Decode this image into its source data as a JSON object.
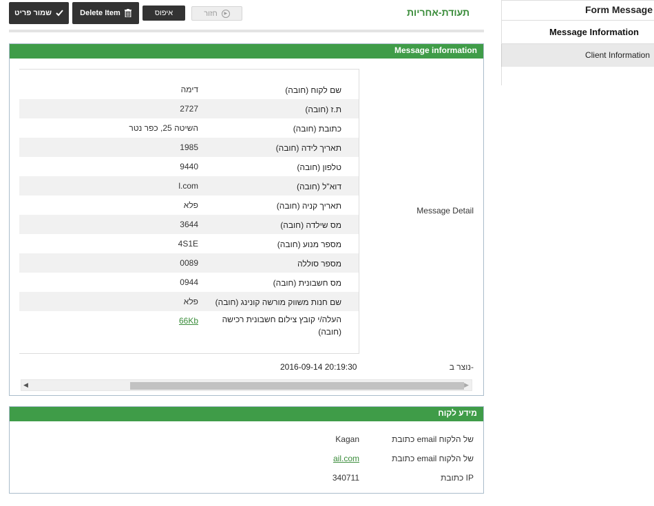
{
  "sidebar": {
    "title": "Form Message",
    "items": [
      {
        "label": "Message Information"
      },
      {
        "label": "Client Information"
      }
    ]
  },
  "toolbar": {
    "save_label": "שמור פריט",
    "delete_label": "Delete Item",
    "reset_label": "איפוס",
    "back_label": "חזור",
    "page_title": "תעודת-אחריות"
  },
  "message_panel": {
    "heading": "Message information",
    "detail_label": "Message Detail",
    "rows": [
      {
        "label": "שם לקוח (חובה)",
        "value": "דימה"
      },
      {
        "label": "ת.ז (חובה)",
        "value": "2727"
      },
      {
        "label": "כתובת (חובה)",
        "value": "השיטה 25, כפר נטר"
      },
      {
        "label": "תאריך לידה (חובה)",
        "value": "1985"
      },
      {
        "label": "טלפון (חובה)",
        "value": "9440"
      },
      {
        "label": "דוא\"ל (חובה)",
        "value": "l.com"
      },
      {
        "label": "תאריך קניה (חובה)",
        "value": "פלא"
      },
      {
        "label": "מס שילדה (חובה)",
        "value": "3644"
      },
      {
        "label": "מספר מנוע (חובה)",
        "value": "4S1E"
      },
      {
        "label": "מספר סוללה",
        "value": "0089"
      },
      {
        "label": "מס חשבונית (חובה)",
        "value": "0944"
      },
      {
        "label": "שם חנות משווק מורשה קונינג (חובה)",
        "value": "פלא"
      },
      {
        "label": "העלה/י קובץ צילום חשבונית רכישה (חובה)",
        "value": "66Kb"
      }
    ],
    "created_label": "נוצר ב-",
    "created_value": "2016-09-14 20:19:30"
  },
  "client_panel": {
    "heading": "מידע לקוח",
    "rows": [
      {
        "label": "כתובת email של הלקוח",
        "value": "Kagan"
      },
      {
        "label": "כתובת email של הלקוח",
        "value": "ail.com"
      },
      {
        "label": "כתובת IP",
        "value": "340711"
      }
    ]
  }
}
